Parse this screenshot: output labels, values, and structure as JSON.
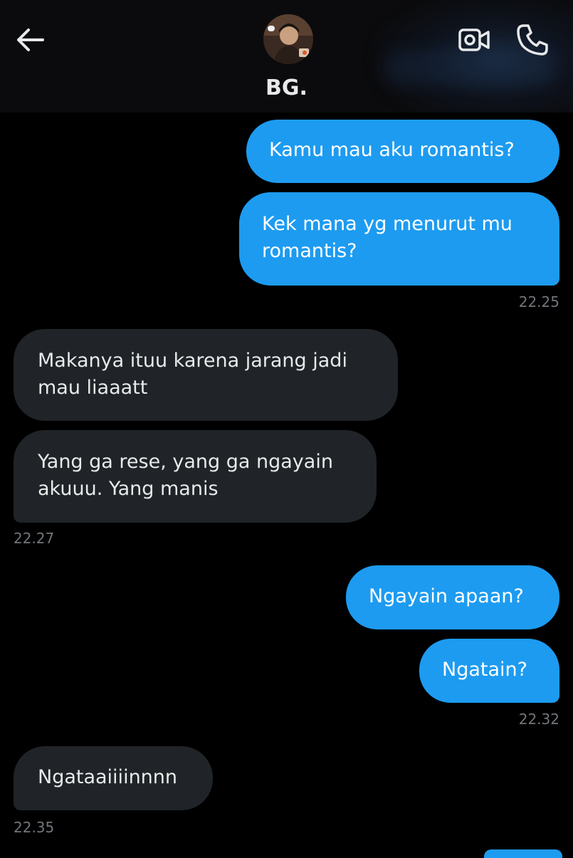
{
  "header": {
    "contact_name": "BG.",
    "avatar_alt": "BG. profile picture"
  },
  "colors": {
    "accent": "#1d9bf0",
    "background": "#000000",
    "incoming_bubble": "#202327",
    "timestamp": "#71767b"
  },
  "icons": {
    "back": "arrow-left-icon",
    "video": "video-camera-icon",
    "call": "phone-icon"
  },
  "messages": [
    {
      "direction": "out",
      "text": "Kamu mau aku romantis?"
    },
    {
      "direction": "out",
      "text": "Kek mana yg menurut mu romantis?",
      "time": "22.25"
    },
    {
      "direction": "in",
      "text": "Makanya ituu karena jarang jadi mau liaaatt"
    },
    {
      "direction": "in",
      "text": "Yang ga rese, yang ga ngayain akuuu. Yang manis",
      "time": "22.27"
    },
    {
      "direction": "out",
      "text": "Ngayain apaan?"
    },
    {
      "direction": "out",
      "text": "Ngatain?",
      "time": "22.32"
    },
    {
      "direction": "in",
      "text": "Ngataaiiiinnnn",
      "time": "22.35"
    }
  ]
}
